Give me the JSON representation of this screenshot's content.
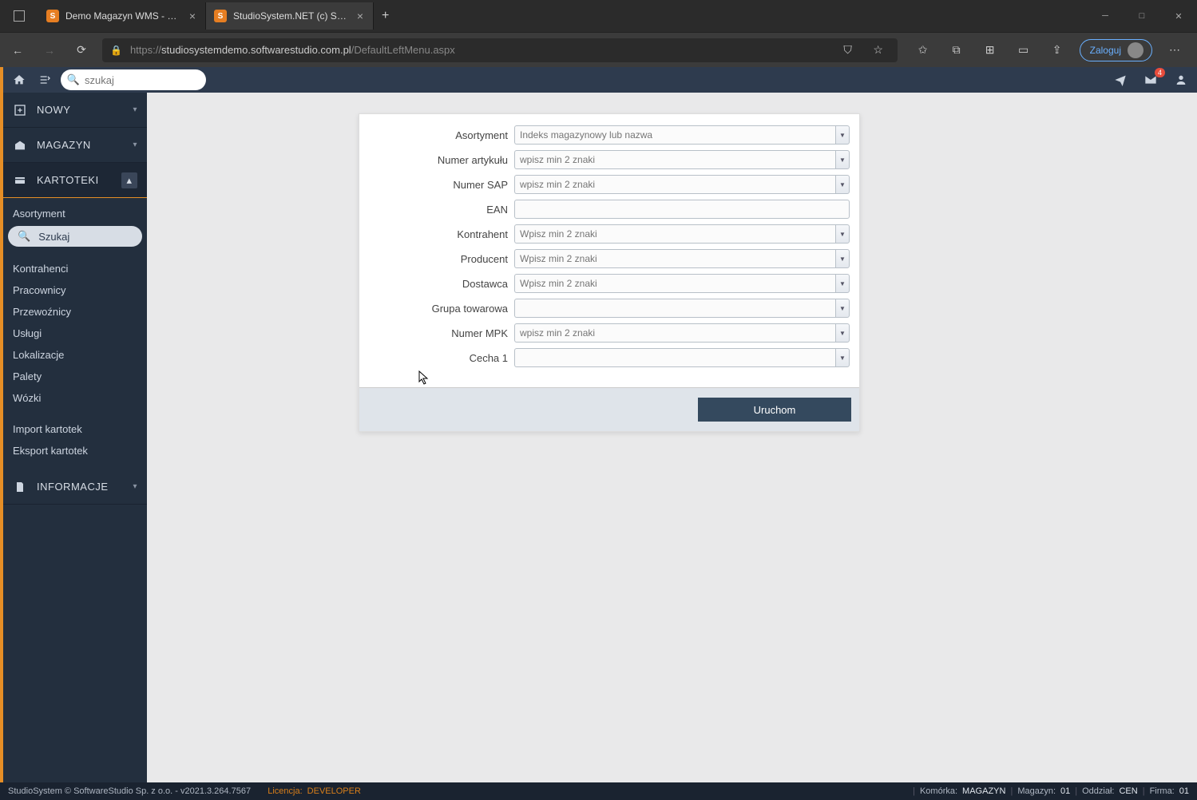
{
  "browser": {
    "tabs": [
      {
        "title": "Demo Magazyn WMS - Demo o"
      },
      {
        "title": "StudioSystem.NET (c) SoftwareSt"
      }
    ],
    "url_proto": "https://",
    "url_host": "studiosystemdemo.softwarestudio.com.pl",
    "url_path": "/DefaultLeftMenu.aspx",
    "login_label": "Zaloguj"
  },
  "topbar": {
    "search_placeholder": "szukaj",
    "mail_badge": "4"
  },
  "sidebar": {
    "sections": [
      {
        "label": "NOWY",
        "expanded": false
      },
      {
        "label": "MAGAZYN",
        "expanded": false
      },
      {
        "label": "KARTOTEKI",
        "expanded": true
      },
      {
        "label": "INFORMACJE",
        "expanded": false
      }
    ],
    "kartoteki_items": [
      "Asortyment",
      "Szukaj",
      "Kontrahenci",
      "Pracownicy",
      "Przewoźnicy",
      "Usługi",
      "Lokalizacje",
      "Palety",
      "Wózki",
      "Import kartotek",
      "Eksport kartotek"
    ]
  },
  "form": {
    "fields": [
      {
        "label": "Asortyment",
        "placeholder": "Indeks magazynowy lub nazwa",
        "type": "combo"
      },
      {
        "label": "Numer artykułu",
        "placeholder": "wpisz min 2 znaki",
        "type": "combo"
      },
      {
        "label": "Numer SAP",
        "placeholder": "wpisz min 2 znaki",
        "type": "combo"
      },
      {
        "label": "EAN",
        "placeholder": "",
        "type": "text"
      },
      {
        "label": "Kontrahent",
        "placeholder": "Wpisz min 2 znaki",
        "type": "combo"
      },
      {
        "label": "Producent",
        "placeholder": "Wpisz min 2 znaki",
        "type": "combo"
      },
      {
        "label": "Dostawca",
        "placeholder": "Wpisz min 2 znaki",
        "type": "combo"
      },
      {
        "label": "Grupa towarowa",
        "placeholder": "",
        "type": "combo"
      },
      {
        "label": "Numer MPK",
        "placeholder": "wpisz min 2 znaki",
        "type": "combo"
      },
      {
        "label": "Cecha 1",
        "placeholder": "",
        "type": "combo"
      }
    ],
    "run_button": "Uruchom"
  },
  "statusbar": {
    "copyright": "StudioSystem © SoftwareStudio Sp. z o.o. - v2021.3.264.7567",
    "license_label": "Licencja:",
    "license_value": "DEVELOPER",
    "right": [
      {
        "label": "Komórka:",
        "value": "MAGAZYN"
      },
      {
        "label": "Magazyn:",
        "value": "01"
      },
      {
        "label": "Oddział:",
        "value": "CEN"
      },
      {
        "label": "Firma:",
        "value": "01"
      }
    ]
  }
}
